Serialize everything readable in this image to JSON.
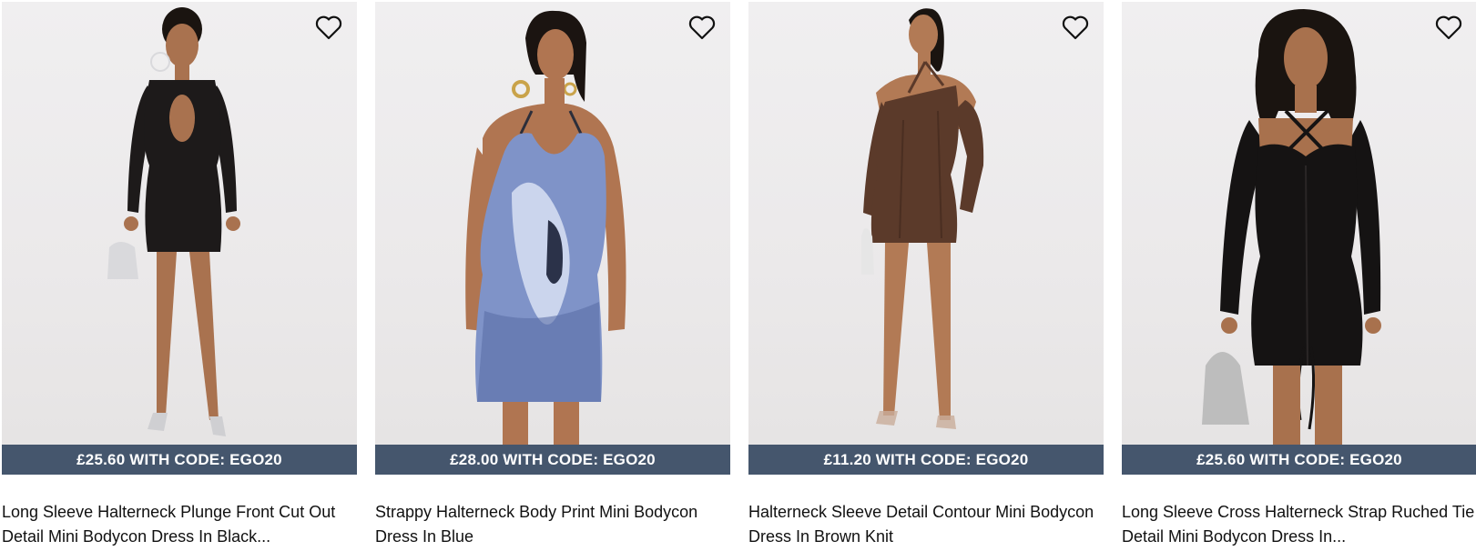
{
  "products": [
    {
      "promo": "£25.60 WITH CODE: EGO20",
      "title": "Long Sleeve Halterneck Plunge Front Cut Out Detail Mini Bodycon Dress In Black...",
      "wishlist_icon": "heart-outline-icon",
      "dress_color": "#1d1a1a",
      "skin_color": "#a9724f",
      "hair_color": "#1a1410",
      "accessory_color": "#d9d9dc"
    },
    {
      "promo": "£28.00 WITH CODE: EGO20",
      "title": "Strappy Halterneck Body Print Mini Bodycon Dress In Blue",
      "wishlist_icon": "heart-outline-icon",
      "dress_color": "#7f93c8",
      "skin_color": "#b07551",
      "hair_color": "#1b1411",
      "accessory_color": "#c9a34a"
    },
    {
      "promo": "£11.20 WITH CODE: EGO20",
      "title": "Halterneck Sleeve Detail Contour Mini Bodycon Dress In Brown Knit",
      "wishlist_icon": "heart-outline-icon",
      "dress_color": "#5b3a2a",
      "skin_color": "#b27a55",
      "hair_color": "#1a1410",
      "accessory_color": "#e6e6e6"
    },
    {
      "promo": "£25.60 WITH CODE: EGO20",
      "title": "Long Sleeve Cross Halterneck Strap Ruched Tie Detail Mini Bodycon Dress In...",
      "wishlist_icon": "heart-outline-icon",
      "dress_color": "#151313",
      "skin_color": "#a8714d",
      "hair_color": "#1a1410",
      "accessory_color": "#bdbdbd"
    }
  ],
  "colors": {
    "promo_bar": "#45566d",
    "background": "#ffffff",
    "text": "#111111"
  }
}
